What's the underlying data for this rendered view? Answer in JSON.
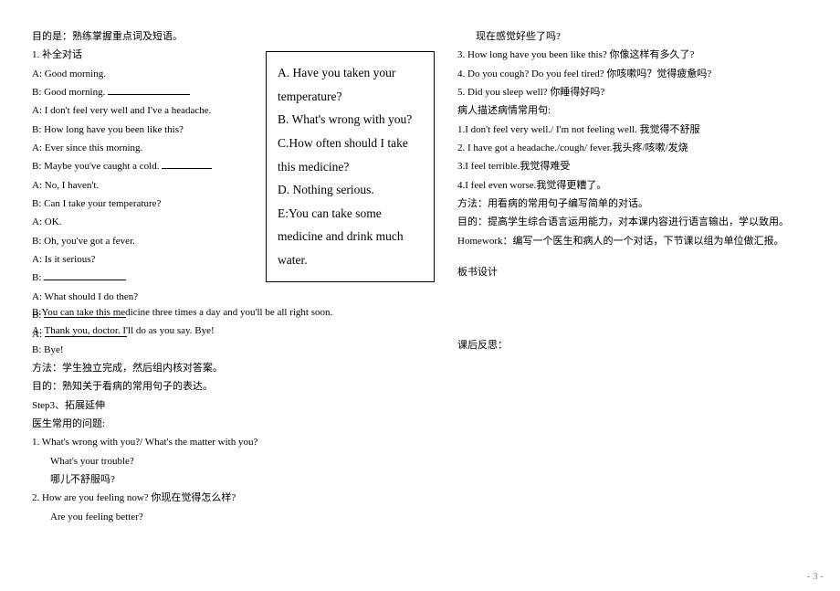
{
  "left": {
    "purpose": "目的是：熟练掌握重点词及短语。",
    "task1": "1. 补全对话",
    "lines": [
      "A: Good morning.",
      "B: Good morning.",
      "A: I don't feel very well and I've a headache.",
      "B: How long have you been like this?",
      "A: Ever since this morning.",
      "B: Maybe you've caught a cold.",
      "A: No, I haven't.",
      "B: Can I take your temperature?",
      "A: OK.",
      "B: Oh, you've got a fever.",
      "A: Is it serious?",
      "B:",
      "A: What should I do then?",
      "B:",
      "A:"
    ]
  },
  "box": {
    "a": "A. Have you taken your temperature?",
    "b": "B. What's wrong with you?",
    "c": "C.How often should I take this medicine?",
    "d": "D. Nothing serious.",
    "e": "E:You can take some medicine and drink much water."
  },
  "full": {
    "l1": "B:You can take this medicine three times a day and  you'll be all right soon.",
    "l2": "A: Thank you, doctor.  I'll do as you say. Bye!",
    "l3": "B: Bye!",
    "l4": "方法：学生独立完成，然后组内核对答案。",
    "l5": "目的：熟知关于看病的常用句子的表达。",
    "l6": "Step3、拓展延伸",
    "l7": "医生常用的问题:",
    "l8": "1.  What's wrong with you?/ What's the matter with you?",
    "l9": "What's your  trouble?",
    "l10": "哪儿不舒服吗?",
    "l11": "2. How are you feeling now? 你现在觉得怎么样?",
    "l12": "Are you feeling better?"
  },
  "right": {
    "r0": "现在感觉好些了吗?",
    "r1": "3. How long have you been like this? 你像这样有多久了?",
    "r2": "4. Do you cough? Do you feel tired? 你咳嗽吗？觉得疲惫吗?",
    "r3": "5. Did you sleep well? 你睡得好吗?",
    "r4": "病人描述病情常用句:",
    "r5": "1.I don't feel very well./ I'm not feeling well. 我觉得不舒服",
    "r6": "2. I have got a headache./cough/ fever.我头疼/咳嗽/发烧",
    "r7": "3.I feel terrible.我觉得难受",
    "r8": "4.I feel even worse.我觉得更糟了。",
    "r9": "方法：用看病的常用句子编写简单的对话。",
    "r10": "目的：提高学生综合语言运用能力，对本课内容进行语言输出，学以致用。",
    "r11": "Homework：编写一个医生和病人的一个对话，下节课以组为单位做汇报。",
    "r12": "板书设计",
    "r13": "课后反思："
  },
  "pagenum": "- 3 -"
}
